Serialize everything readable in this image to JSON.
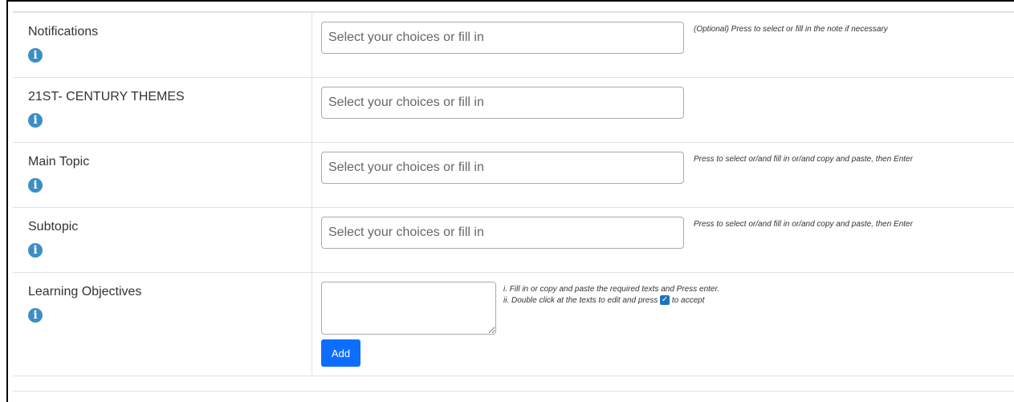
{
  "rows": [
    {
      "label": "Notifications",
      "placeholder": "Select your choices or fill in",
      "note": "(Optional) Press to select or fill in the note if necessary"
    },
    {
      "label": "21ST- CENTURY THEMES",
      "placeholder": "Select your choices or fill in",
      "note": ""
    },
    {
      "label": "Main Topic",
      "placeholder": "Select your choices or fill in",
      "note": "Press to select or/and fill in or/and copy and paste, then Enter"
    },
    {
      "label": "Subtopic",
      "placeholder": "Select your choices or fill in",
      "note": "Press to select or/and fill in or/and copy and paste, then Enter"
    }
  ],
  "learning_objectives": {
    "label": "Learning Objectives",
    "add_label": "Add",
    "note_line1": "i. Fill in or copy and paste the required texts and Press enter.",
    "note_line2_a": "ii. Double click at the texts to edit and press",
    "note_line2_b": "to accept",
    "check_icon_glyph": "✓"
  },
  "info_icon_glyph": "i",
  "colors": {
    "accent": "#0d6efd",
    "info": "#3d8ec4"
  }
}
